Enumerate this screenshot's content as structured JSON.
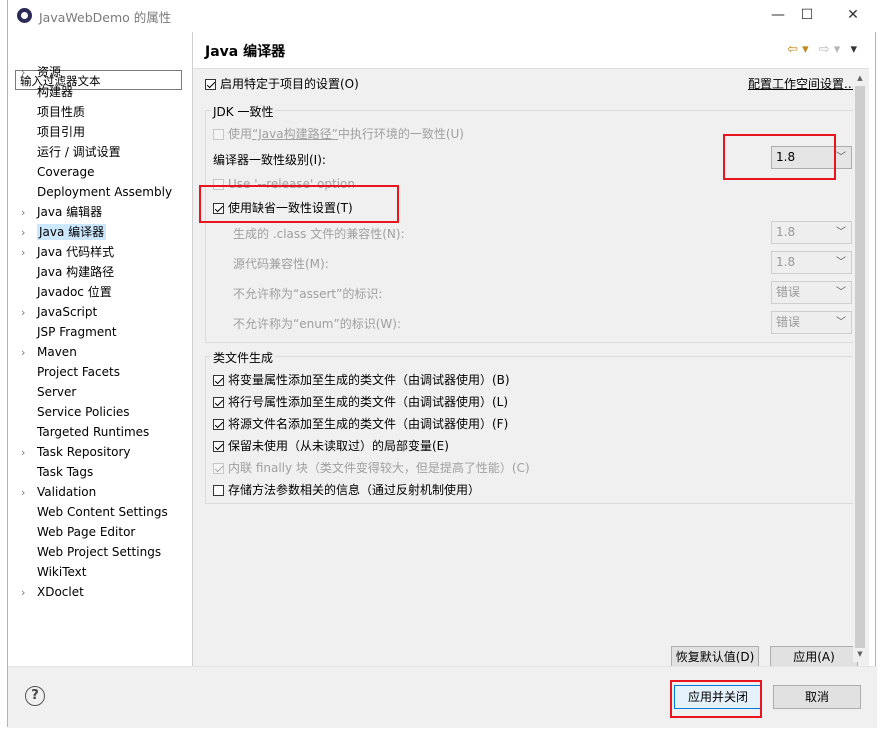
{
  "window": {
    "title": "JavaWebDemo 的属性",
    "minimize": "—",
    "maximize": "☐",
    "close": "✕"
  },
  "filter_placeholder": "输入过滤器文本",
  "tree": [
    {
      "label": "资源",
      "chev": true
    },
    {
      "label": "构建器",
      "chev": false
    },
    {
      "label": "项目性质",
      "chev": false
    },
    {
      "label": "项目引用",
      "chev": false
    },
    {
      "label": "运行 / 调试设置",
      "chev": false
    },
    {
      "label": "Coverage",
      "chev": false
    },
    {
      "label": "Deployment Assembly",
      "chev": false
    },
    {
      "label": "Java 编辑器",
      "chev": true
    },
    {
      "label": "Java 编译器",
      "chev": true,
      "selected": true
    },
    {
      "label": "Java 代码样式",
      "chev": true
    },
    {
      "label": "Java 构建路径",
      "chev": false
    },
    {
      "label": "Javadoc 位置",
      "chev": false
    },
    {
      "label": "JavaScript",
      "chev": true
    },
    {
      "label": "JSP Fragment",
      "chev": false
    },
    {
      "label": "Maven",
      "chev": true
    },
    {
      "label": "Project Facets",
      "chev": false
    },
    {
      "label": "Server",
      "chev": false
    },
    {
      "label": "Service Policies",
      "chev": false
    },
    {
      "label": "Targeted Runtimes",
      "chev": false
    },
    {
      "label": "Task Repository",
      "chev": true
    },
    {
      "label": "Task Tags",
      "chev": false
    },
    {
      "label": "Validation",
      "chev": true
    },
    {
      "label": "Web Content Settings",
      "chev": false
    },
    {
      "label": "Web Page Editor",
      "chev": false
    },
    {
      "label": "Web Project Settings",
      "chev": false
    },
    {
      "label": "WikiText",
      "chev": false
    },
    {
      "label": "XDoclet",
      "chev": true
    }
  ],
  "page": {
    "title": "Java 编译器",
    "enable_project_settings": "启用特定于项目的设置(O)",
    "configure_workspace": "配置工作空间设置...",
    "jdk_group": "JDK 一致性",
    "use_build_path_prefix": "使用",
    "use_build_path_link": "“Java构建路径”",
    "use_build_path_suffix": "中执行环境的一致性(U)",
    "compliance_level_label": "编译器一致性级别(I):",
    "compliance_level_value": "1.8",
    "release_option": "Use '--release' option",
    "use_default": "使用缺省一致性设置(T)",
    "class_compat_label": "生成的 .class 文件的兼容性(N):",
    "class_compat_value": "1.8",
    "source_compat_label": "源代码兼容性(M):",
    "source_compat_value": "1.8",
    "assert_label": "不允许称为“assert”的标识:",
    "assert_value": "错误",
    "enum_label": "不允许称为“enum”的标识(W):",
    "enum_value": "错误",
    "classfile_group": "类文件生成",
    "classfile_options": [
      {
        "label": "将变量属性添加至生成的类文件（由调试器使用）(B)",
        "checked": true,
        "disabled": false
      },
      {
        "label": "将行号属性添加至生成的类文件（由调试器使用）(L)",
        "checked": true,
        "disabled": false
      },
      {
        "label": "将源文件名添加至生成的类文件（由调试器使用）(F)",
        "checked": true,
        "disabled": false
      },
      {
        "label": "保留未使用（从未读取过）的局部变量(E)",
        "checked": true,
        "disabled": false
      },
      {
        "label": "内联 finally 块（类文件变得较大，但是提高了性能）(C)",
        "checked": true,
        "disabled": true
      },
      {
        "label": "存储方法参数相关的信息（通过反射机制使用）",
        "checked": false,
        "disabled": false
      }
    ],
    "restore_defaults": "恢复默认值(D)",
    "apply": "应用(A)"
  },
  "bottom": {
    "help": "?",
    "apply_and_close": "应用并关闭",
    "cancel": "取消"
  },
  "highlight_color": "#e8141e"
}
